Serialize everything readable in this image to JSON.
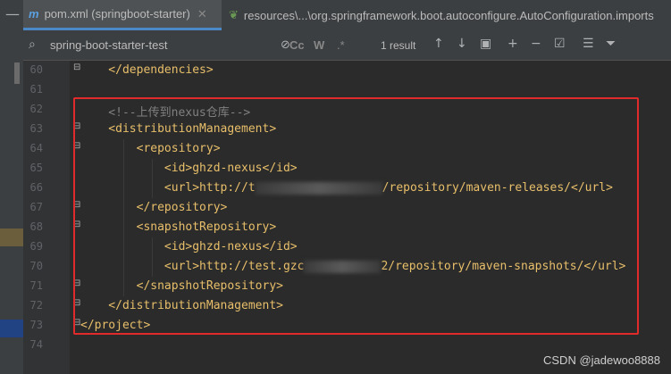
{
  "tabs": [
    {
      "label": "pom.xml (springboot-starter)",
      "icon": "m-icon"
    },
    {
      "label": "resources\\...\\org.springframework.boot.autoconfigure.AutoConfiguration.imports",
      "icon": "leaf-icon"
    }
  ],
  "search": {
    "query": "spring-boot-starter-test",
    "options": [
      "Cc",
      "W",
      ".*"
    ],
    "result": "1 result"
  },
  "lines": [
    {
      "n": "60",
      "text": "    </dependencies>"
    },
    {
      "n": "61",
      "text": ""
    },
    {
      "n": "62",
      "text": "    <!--上传到nexus仓库-->"
    },
    {
      "n": "63",
      "text": "    <distributionManagement>"
    },
    {
      "n": "64",
      "text": "        <repository>"
    },
    {
      "n": "65",
      "text": "            <id>ghzd-nexus</id>"
    },
    {
      "n": "66",
      "text": "            <url>http://t",
      "tail": "/repository/maven-releases/</url>"
    },
    {
      "n": "67",
      "text": "        </repository>"
    },
    {
      "n": "68",
      "text": "        <snapshotRepository>"
    },
    {
      "n": "69",
      "text": "            <id>ghzd-nexus</id>"
    },
    {
      "n": "70",
      "text": "            <url>http://test.gzc",
      "tail": "2/repository/maven-snapshots/</url>"
    },
    {
      "n": "71",
      "text": "        </snapshotRepository>"
    },
    {
      "n": "72",
      "text": "    </distributionManagement>"
    },
    {
      "n": "73",
      "text": "</project>"
    },
    {
      "n": "74",
      "text": ""
    }
  ],
  "watermark": "CSDN @jadewoo8888",
  "colors": {
    "tag": "#e8bf6a",
    "text": "#a9b7c6",
    "comment": "#808080",
    "highlight": "#e12b2b"
  }
}
